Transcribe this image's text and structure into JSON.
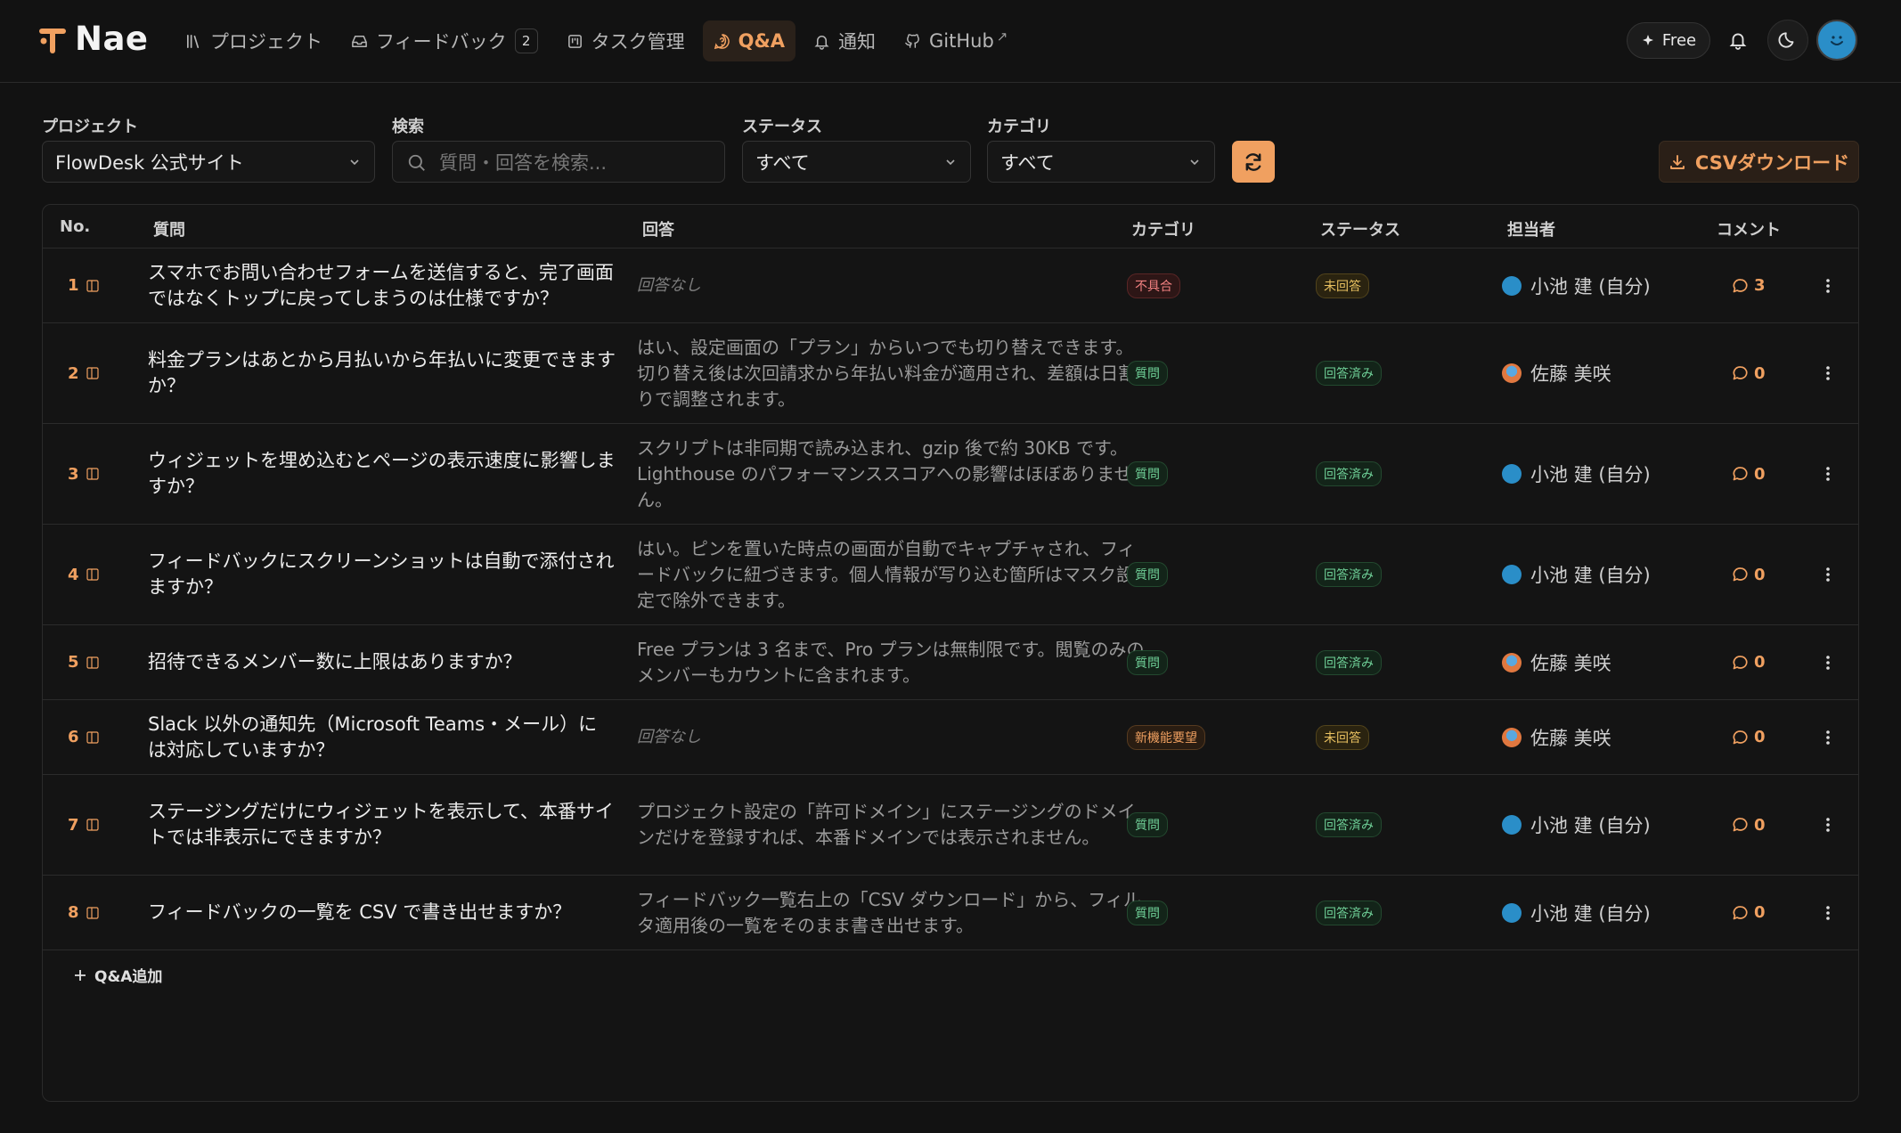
{
  "app": {
    "name": "Nae"
  },
  "nav": [
    {
      "label": "プロジェクト",
      "icon": "library-icon"
    },
    {
      "label": "フィードバック",
      "icon": "inbox-icon",
      "badge": "2"
    },
    {
      "label": "タスク管理",
      "icon": "board-icon"
    },
    {
      "label": "Q&A",
      "icon": "question-icon",
      "active": true
    },
    {
      "label": "通知",
      "icon": "bell-icon"
    },
    {
      "label": "GitHub",
      "icon": "github-icon",
      "external_mark": "↗"
    }
  ],
  "header": {
    "plan_label": "Free"
  },
  "filters": {
    "project": {
      "label": "プロジェクト",
      "value": "FlowDesk 公式サイト"
    },
    "search": {
      "label": "検索",
      "placeholder": "質問・回答を検索..."
    },
    "status": {
      "label": "ステータス",
      "value": "すべて"
    },
    "category": {
      "label": "カテゴリ",
      "value": "すべて"
    },
    "csv_label": "CSVダウンロード"
  },
  "table": {
    "headers": {
      "no": "No.",
      "question": "質問",
      "answer": "回答",
      "category": "カテゴリ",
      "status": "ステータス",
      "assignee": "担当者",
      "comment": "コメント"
    },
    "rows": [
      {
        "no": "1",
        "question": "スマホでお問い合わせフォームを送信すると、完了画面ではなくトップに戻ってしまうのは仕様ですか？",
        "answer": "回答なし",
        "category": "不具合",
        "status": "未回答",
        "assignee": "小池 建 (自分)",
        "comments": "3"
      },
      {
        "no": "2",
        "question": "料金プランはあとから月払いから年払いに変更できますか？",
        "answer": "はい、設定画面の「プラン」からいつでも切り替えできます。切り替え後は次回請求から年払い料金が適用され、差額は日割りで調整されます。",
        "category": "質問",
        "status": "回答済み",
        "assignee": "佐藤 美咲",
        "comments": "0"
      },
      {
        "no": "3",
        "question": "ウィジェットを埋め込むとページの表示速度に影響しますか？",
        "answer": "スクリプトは非同期で読み込まれ、gzip 後で約 30KB です。Lighthouse のパフォーマンススコアへの影響はほぼありません。",
        "category": "質問",
        "status": "回答済み",
        "assignee": "小池 建 (自分)",
        "comments": "0"
      },
      {
        "no": "4",
        "question": "フィードバックにスクリーンショットは自動で添付されますか？",
        "answer": "はい。ピンを置いた時点の画面が自動でキャプチャされ、フィードバックに紐づきます。個人情報が写り込む箇所はマスク設定で除外できます。",
        "category": "質問",
        "status": "回答済み",
        "assignee": "小池 建 (自分)",
        "comments": "0"
      },
      {
        "no": "5",
        "question": "招待できるメンバー数に上限はありますか？",
        "answer": "Free プランは 3 名まで、Pro プランは無制限です。閲覧のみのメンバーもカウントに含まれます。",
        "category": "質問",
        "status": "回答済み",
        "assignee": "佐藤 美咲",
        "comments": "0"
      },
      {
        "no": "6",
        "question": "Slack 以外の通知先（Microsoft Teams・メール）には対応していますか？",
        "answer": "回答なし",
        "category": "新機能要望",
        "status": "未回答",
        "assignee": "佐藤 美咲",
        "comments": "0"
      },
      {
        "no": "7",
        "question": "ステージングだけにウィジェットを表示して、本番サイトでは非表示にできますか？",
        "answer": "プロジェクト設定の「許可ドメイン」にステージングのドメインだけを登録すれば、本番ドメインでは表示されません。",
        "category": "質問",
        "status": "回答済み",
        "assignee": "小池 建 (自分)",
        "comments": "0"
      },
      {
        "no": "8",
        "question": "フィードバックの一覧を CSV で書き出せますか？",
        "answer": "フィードバック一覧右上の「CSV ダウンロード」から、フィルタ適用後の一覧をそのまま書き出せます。",
        "category": "質問",
        "status": "回答済み",
        "assignee": "小池 建 (自分)",
        "comments": "0"
      }
    ],
    "add_label": "Q&A追加"
  },
  "colors": {
    "accent": "#f0a060",
    "background": "#121212"
  }
}
